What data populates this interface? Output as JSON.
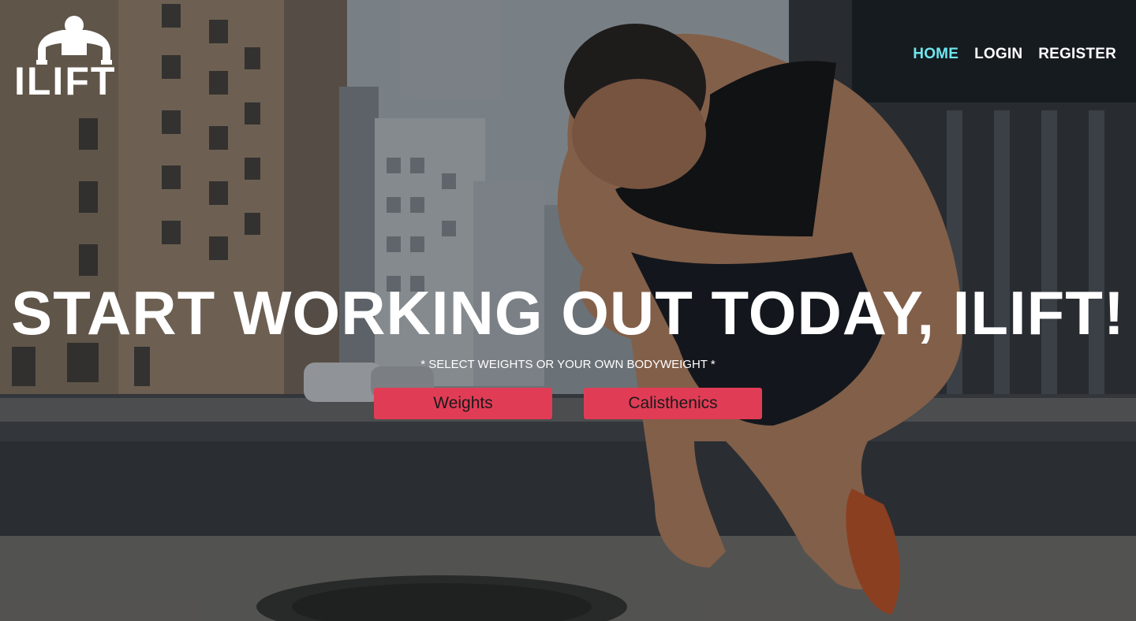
{
  "brand": {
    "name": "ILIFT"
  },
  "nav": {
    "home": "HOME",
    "login": "LOGIN",
    "register": "REGISTER"
  },
  "hero": {
    "headline": "START WORKING OUT TODAY, ILIFT!",
    "subline": "* SELECT WEIGHTS OR YOUR OWN BODYWEIGHT *",
    "buttons": {
      "weights": "Weights",
      "calisthenics": "Calisthenics"
    }
  },
  "colors": {
    "accent": "#e13c56",
    "nav_active": "#6fe6ee",
    "text": "#ffffff"
  }
}
